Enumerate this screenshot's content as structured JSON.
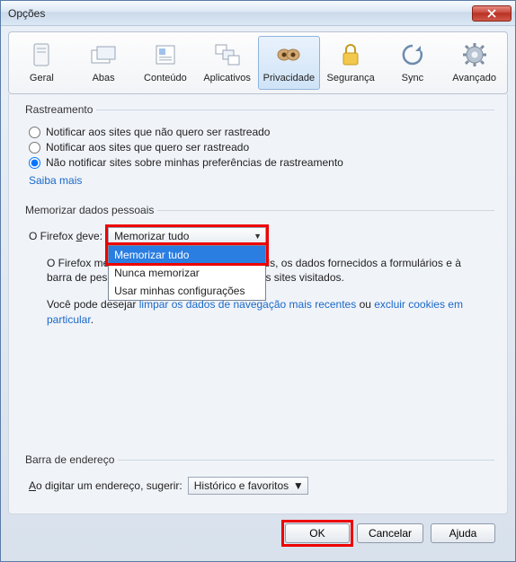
{
  "window": {
    "title": "Opções"
  },
  "toolbar": {
    "items": [
      {
        "label": "Geral"
      },
      {
        "label": "Abas"
      },
      {
        "label": "Conteúdo"
      },
      {
        "label": "Aplicativos"
      },
      {
        "label": "Privacidade"
      },
      {
        "label": "Segurança"
      },
      {
        "label": "Sync"
      },
      {
        "label": "Avançado"
      }
    ],
    "selected_index": 4
  },
  "tracking": {
    "legend": "Rastreamento",
    "opt_no_track": "Notificar aos sites que não quero ser rastreado",
    "opt_track": "Notificar aos sites que quero ser rastreado",
    "opt_none": "Não notificar sites sobre minhas preferências de rastreamento",
    "selected": "opt_none",
    "learn_more": "Saiba mais"
  },
  "history": {
    "legend": "Memorizar dados pessoais",
    "label_prefix": "O Firefox deve:",
    "label_prefix_underline_index": 10,
    "selected": "Memorizar tudo",
    "options": [
      "Memorizar tudo",
      "Nunca memorizar",
      "Usar minhas configurações"
    ],
    "dropdown_selected_index": 0,
    "desc_line": "O Firefox memorizará o histórico, os downloads, os dados fornecidos a formulários e à barra de pesquisa e preservará os cookies dos sites visitados.",
    "wish_prefix": "Você pode desejar ",
    "wish_link1": "limpar os dados de navegação mais recentes",
    "wish_mid": " ou ",
    "wish_link2": "excluir cookies em particular",
    "wish_suffix": "."
  },
  "addressbar": {
    "legend": "Barra de endereço",
    "label": "Ao digitar um endereço, sugerir:",
    "label_underline_index": 0,
    "value": "Histórico e favoritos"
  },
  "buttons": {
    "ok": "OK",
    "cancel": "Cancelar",
    "help": "Ajuda"
  }
}
